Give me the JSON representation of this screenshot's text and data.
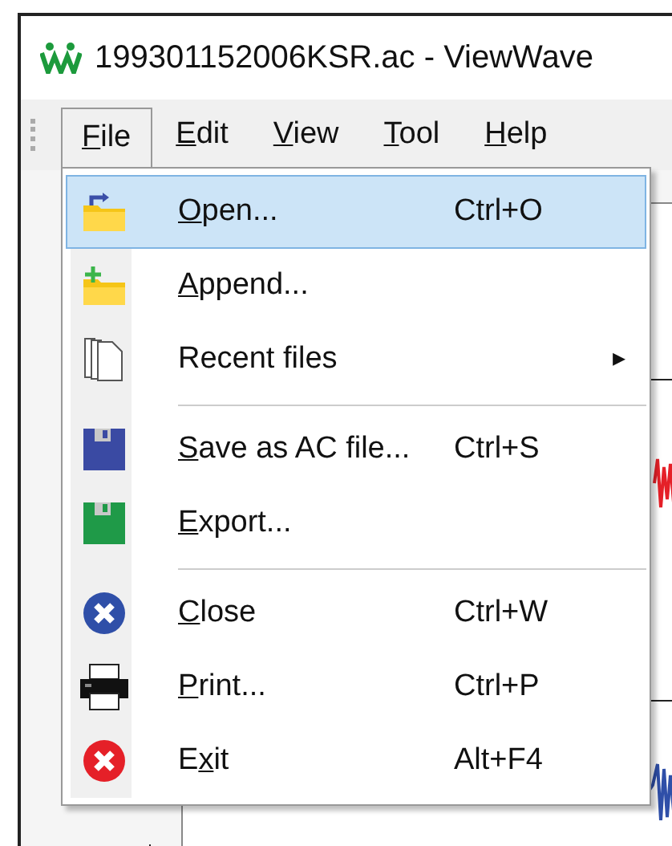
{
  "window": {
    "title": "199301152006KSR.ac - ViewWave"
  },
  "menu_bar": [
    {
      "key": "F",
      "after": "ile",
      "selected": true
    },
    {
      "key": "E",
      "after": "dit",
      "selected": false
    },
    {
      "key": "V",
      "after": "iew",
      "selected": false
    },
    {
      "key": "T",
      "after": "ool",
      "selected": false
    },
    {
      "key": "H",
      "after": "elp",
      "selected": false
    }
  ],
  "file_menu": [
    {
      "kind": "item",
      "key": "O",
      "after": "pen...",
      "shortcut": "Ctrl+O",
      "selected": true
    },
    {
      "kind": "item",
      "key": "A",
      "after": "ppend...",
      "selected": false
    },
    {
      "kind": "submenu",
      "before": "Recent files",
      "arrow": "▸",
      "selected": false
    },
    {
      "kind": "separator"
    },
    {
      "kind": "item",
      "key": "S",
      "after": "ave as AC file...",
      "shortcut": "Ctrl+S",
      "selected": false
    },
    {
      "kind": "item",
      "key": "E",
      "after": "xport...",
      "selected": false
    },
    {
      "kind": "separator"
    },
    {
      "kind": "item",
      "key": "C",
      "after": "lose",
      "shortcut": "Ctrl+W",
      "selected": false
    },
    {
      "kind": "item",
      "key": "P",
      "after": "rint...",
      "shortcut": "Ctrl+P",
      "selected": false
    },
    {
      "kind": "item",
      "before": "E",
      "key": "x",
      "after": "it",
      "shortcut": "Alt+F4",
      "selected": false
    }
  ]
}
